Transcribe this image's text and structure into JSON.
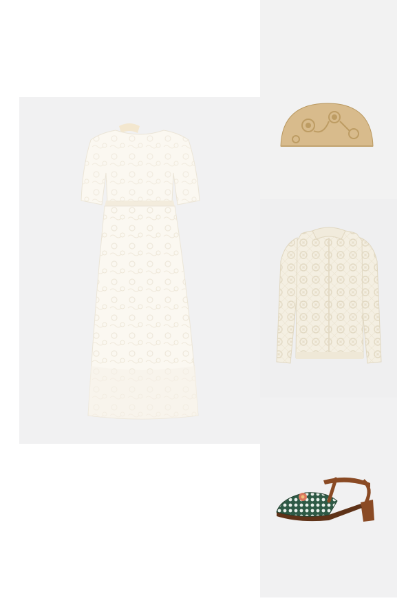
{
  "outfit": {
    "items": [
      {
        "name": "lace-midi-dress",
        "color": "#faf6ee"
      },
      {
        "name": "raffia-clutch",
        "color": "#d6b98a"
      },
      {
        "name": "crochet-cardigan",
        "color": "#f3eddd"
      },
      {
        "name": "t-bar-sandal",
        "color": "#8a4a24"
      }
    ]
  }
}
